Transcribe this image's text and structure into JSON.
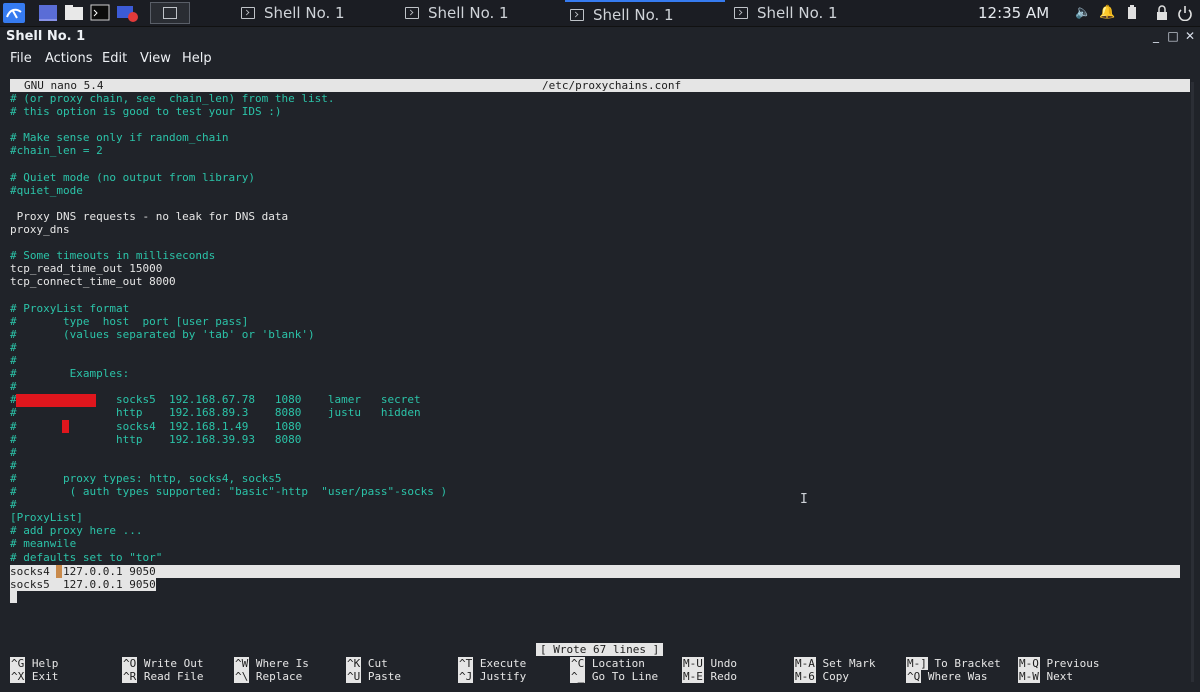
{
  "panel": {
    "tasks": [
      {
        "label": "Shell No. 1"
      },
      {
        "label": "Shell No. 1"
      },
      {
        "label": "Shell No. 1"
      },
      {
        "label": "Shell No. 1"
      }
    ],
    "clock": "12:35 AM"
  },
  "window": {
    "title": "Shell No. 1"
  },
  "menubar": [
    "File",
    "Actions",
    "Edit",
    "View",
    "Help"
  ],
  "nano": {
    "version": "GNU nano 5.4",
    "file": "/etc/proxychains.conf",
    "status": "[ Wrote 67 lines ]",
    "lines": [
      {
        "text": "# (or proxy chain, see  chain_len) from the list.",
        "cls": "c"
      },
      {
        "text": "# this option is good to test your IDS :)",
        "cls": "c"
      },
      {
        "text": "",
        "cls": "c"
      },
      {
        "text": "# Make sense only if random_chain",
        "cls": "c"
      },
      {
        "text": "#chain_len = 2",
        "cls": "c"
      },
      {
        "text": "",
        "cls": "c"
      },
      {
        "text": "# Quiet mode (no output from library)",
        "cls": "c"
      },
      {
        "text": "#quiet_mode",
        "cls": "c"
      },
      {
        "text": "",
        "cls": "c"
      },
      {
        "text": " Proxy DNS requests - no leak for DNS data",
        "cls": "w"
      },
      {
        "text": "proxy_dns",
        "cls": "w"
      },
      {
        "text": "",
        "cls": "c"
      },
      {
        "text": "# Some timeouts in milliseconds",
        "cls": "c"
      },
      {
        "text": "tcp_read_time_out 15000",
        "cls": "w"
      },
      {
        "text": "tcp_connect_time_out 8000",
        "cls": "w"
      },
      {
        "text": "",
        "cls": "c"
      },
      {
        "text": "# ProxyList format",
        "cls": "c"
      },
      {
        "text": "#       type  host  port [user pass]",
        "cls": "c"
      },
      {
        "text": "#       (values separated by 'tab' or 'blank')",
        "cls": "c"
      },
      {
        "text": "#",
        "cls": "c"
      },
      {
        "text": "#",
        "cls": "c"
      },
      {
        "text": "#        Examples:",
        "cls": "c"
      },
      {
        "text": "#",
        "cls": "c"
      },
      {
        "text": "#               socks5  192.168.67.78   1080    lamer   secret",
        "cls": "c"
      },
      {
        "text": "#               http    192.168.89.3    8080    justu   hidden",
        "cls": "c"
      },
      {
        "text": "#               socks4  192.168.1.49    1080",
        "cls": "c"
      },
      {
        "text": "#               http    192.168.39.93   8080",
        "cls": "c"
      },
      {
        "text": "#",
        "cls": "c"
      },
      {
        "text": "#",
        "cls": "c"
      },
      {
        "text": "#       proxy types: http, socks4, socks5",
        "cls": "c"
      },
      {
        "text": "#        ( auth types supported: \"basic\"-http  \"user/pass\"-socks )",
        "cls": "c"
      },
      {
        "text": "#",
        "cls": "c"
      },
      {
        "text": "[ProxyList]",
        "cls": "c"
      },
      {
        "text": "# add proxy here ...",
        "cls": "c"
      },
      {
        "text": "# meanwile",
        "cls": "c"
      },
      {
        "text": "# defaults set to \"tor\"",
        "cls": "c"
      }
    ],
    "selected_lines": [
      "socks4  127.0.0.1 9050",
      "socks5  127.0.0.1 9050"
    ],
    "shortcuts": [
      {
        "key1": "^G",
        "label1": "Help",
        "key2": "^X",
        "label2": "Exit"
      },
      {
        "key1": "^O",
        "label1": "Write Out",
        "key2": "^R",
        "label2": "Read File"
      },
      {
        "key1": "^W",
        "label1": "Where Is",
        "key2": "^\\",
        "label2": "Replace"
      },
      {
        "key1": "^K",
        "label1": "Cut",
        "key2": "^U",
        "label2": "Paste"
      },
      {
        "key1": "^T",
        "label1": "Execute",
        "key2": "^J",
        "label2": "Justify"
      },
      {
        "key1": "^C",
        "label1": "Location",
        "key2": "^_",
        "label2": "Go To Line"
      },
      {
        "key1": "M-U",
        "label1": "Undo",
        "key2": "M-E",
        "label2": "Redo"
      },
      {
        "key1": "M-A",
        "label1": "Set Mark",
        "key2": "M-6",
        "label2": "Copy"
      },
      {
        "key1": "M-]",
        "label1": "To Bracket",
        "key2": "^Q",
        "label2": "Where Was"
      },
      {
        "key1": "M-Q",
        "label1": "Previous",
        "key2": "M-W",
        "label2": "Next"
      }
    ]
  },
  "colors": {
    "comment": "#2bc3a8",
    "text": "#e6e6e6",
    "bg": "#202329",
    "accent": "#367bf0",
    "redaction": "#e0161d"
  }
}
